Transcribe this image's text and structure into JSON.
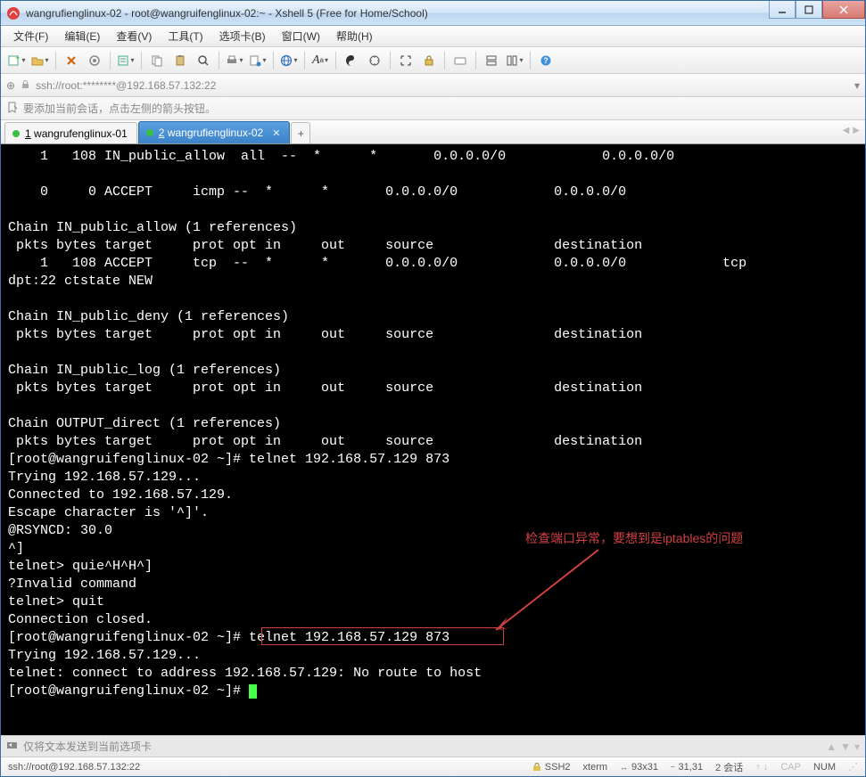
{
  "window": {
    "title": "wangrufienglinux-02 - root@wangruifenglinux-02:~ - Xshell 5 (Free for Home/School)"
  },
  "menu": {
    "file": "文件(F)",
    "edit": "编辑(E)",
    "view": "查看(V)",
    "tools": "工具(T)",
    "tabs": "选项卡(B)",
    "window": "窗口(W)",
    "help": "帮助(H)"
  },
  "address": {
    "text": "ssh://root:********@192.168.57.132:22"
  },
  "infobar": {
    "text": "要添加当前会话，点击左侧的箭头按钮。"
  },
  "tabs": [
    {
      "label_num": "1",
      "label": "wangrufenglinux-01",
      "active": false
    },
    {
      "label_num": "2",
      "label": "wangrufienglinux-02",
      "active": true
    }
  ],
  "terminal": {
    "lines": [
      "    1   108 IN_public_allow  all  --  *      *       0.0.0.0/0            0.0.0.0/0",
      "",
      "    0     0 ACCEPT     icmp --  *      *       0.0.0.0/0            0.0.0.0/0",
      "",
      "Chain IN_public_allow (1 references)",
      " pkts bytes target     prot opt in     out     source               destination",
      "    1   108 ACCEPT     tcp  --  *      *       0.0.0.0/0            0.0.0.0/0            tcp",
      "dpt:22 ctstate NEW",
      "",
      "Chain IN_public_deny (1 references)",
      " pkts bytes target     prot opt in     out     source               destination",
      "",
      "Chain IN_public_log (1 references)",
      " pkts bytes target     prot opt in     out     source               destination",
      "",
      "Chain OUTPUT_direct (1 references)",
      " pkts bytes target     prot opt in     out     source               destination",
      "[root@wangruifenglinux-02 ~]# telnet 192.168.57.129 873",
      "Trying 192.168.57.129...",
      "Connected to 192.168.57.129.",
      "Escape character is '^]'.",
      "@RSYNCD: 30.0",
      "^]",
      "telnet> quie^H^H^]",
      "?Invalid command",
      "telnet> quit",
      "Connection closed.",
      "[root@wangruifenglinux-02 ~]# telnet 192.168.57.129 873",
      "Trying 192.168.57.129...",
      "telnet: connect to address 192.168.57.129: No route to host",
      "[root@wangruifenglinux-02 ~]# "
    ],
    "annotation": "检查端口异常，要想到是iptables的问题"
  },
  "sendbar": {
    "text": "仅将文本发送到当前选项卡"
  },
  "status": {
    "conn": "ssh://root@192.168.57.132:22",
    "proto": "SSH2",
    "termtype": "xterm",
    "size": "93x31",
    "cursor": "31,31",
    "sessions": "2 会话",
    "cap": "CAP",
    "num": "NUM"
  },
  "icons": {
    "new": "new-icon",
    "open": "open-icon",
    "props": "props-icon",
    "copy": "copy-icon",
    "paste": "paste-icon",
    "find": "find-icon",
    "print": "print-icon",
    "logs": "logs-icon",
    "globe": "globe-icon",
    "font": "font-icon",
    "easy": "easy-icon",
    "highlight": "highlight-icon",
    "fullscreen": "fullscreen-icon",
    "lock": "lock-icon",
    "keyboard": "keyboard-icon",
    "tile": "tile-icon",
    "cascade": "cascade-icon",
    "help": "help-icon"
  }
}
